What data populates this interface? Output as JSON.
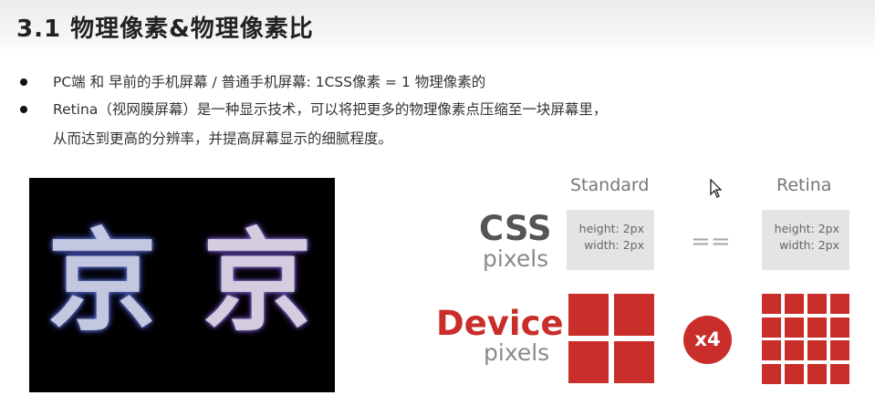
{
  "slide": {
    "title": "3.1 物理像素&物理像素比",
    "bullets": [
      "PC端 和 早前的手机屏幕 / 普通手机屏幕:  1CSS像素  =  1 物理像素的",
      "Retina（视网膜屏幕）是一种显示技术，可以将把更多的物理像素点压缩至一块屏幕里，"
    ],
    "bullet_continuation": "从而达到更高的分辨率，并提高屏幕显示的细腻程度。"
  },
  "photo": {
    "left_glyph": "京",
    "right_glyph": "京"
  },
  "diagram": {
    "col_standard": "Standard",
    "col_retina": "Retina",
    "css_label": "CSS",
    "css_sub": "pixels",
    "device_label": "Device",
    "device_sub": "pixels",
    "standard_box": {
      "height": "height: 2px",
      "width": "width: 2px"
    },
    "retina_box": {
      "height": "height: 2px",
      "width": "width: 2px"
    },
    "equals": "==",
    "multiplier": "x4",
    "standard_grid": {
      "rows": 2,
      "cols": 2
    },
    "retina_grid": {
      "rows": 4,
      "cols": 4
    },
    "colors": {
      "accent": "#c92e2b",
      "css_label": "#555555",
      "box_bg": "#e4e4e4"
    }
  }
}
